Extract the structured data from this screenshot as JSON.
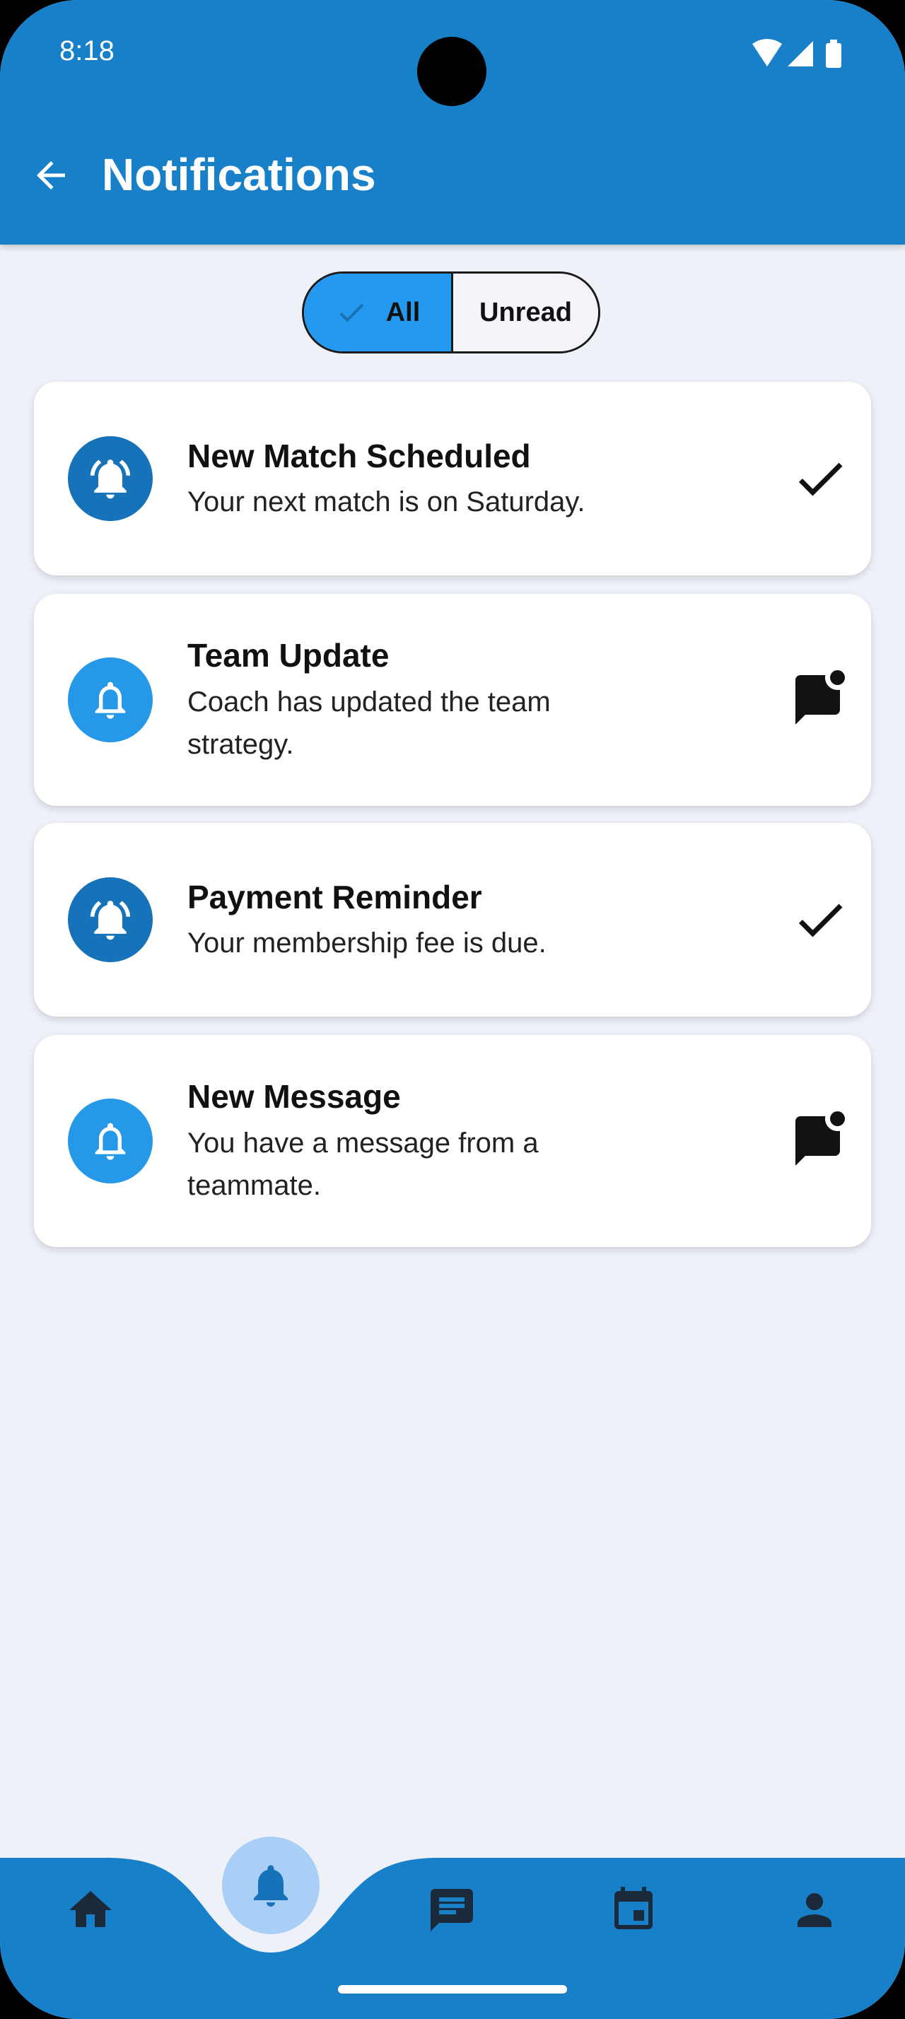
{
  "status_bar": {
    "time": "8:18",
    "icons": [
      "wifi-icon",
      "cellular-signal-icon",
      "battery-icon"
    ]
  },
  "app_bar": {
    "back_icon": "arrow-back-icon",
    "title": "Notifications",
    "color": "#1780c8"
  },
  "filter": {
    "options": [
      {
        "label": "All",
        "selected": true
      },
      {
        "label": "Unread",
        "selected": false
      }
    ],
    "selected_color": "#239af0"
  },
  "notifications": [
    {
      "title": "New Match Scheduled",
      "body": "Your next match is on Saturday.",
      "read": true,
      "trailing_icon": "check-icon"
    },
    {
      "title": "Team Update",
      "body": "Coach has updated the team strategy.",
      "read": false,
      "trailing_icon": "mark-unread-chat-icon"
    },
    {
      "title": "Payment Reminder",
      "body": "Your membership fee is due.",
      "read": true,
      "trailing_icon": "check-icon"
    },
    {
      "title": "New Message",
      "body": "You have a message from a teammate.",
      "read": false,
      "trailing_icon": "mark-unread-chat-icon"
    }
  ],
  "bottom_nav": {
    "items": [
      {
        "icon": "home-icon",
        "active": false
      },
      {
        "icon": "bell-icon",
        "active": true
      },
      {
        "icon": "chat-icon",
        "active": false
      },
      {
        "icon": "calendar-icon",
        "active": false
      },
      {
        "icon": "person-icon",
        "active": false
      }
    ],
    "active_bubble_color": "#a9cff6"
  }
}
